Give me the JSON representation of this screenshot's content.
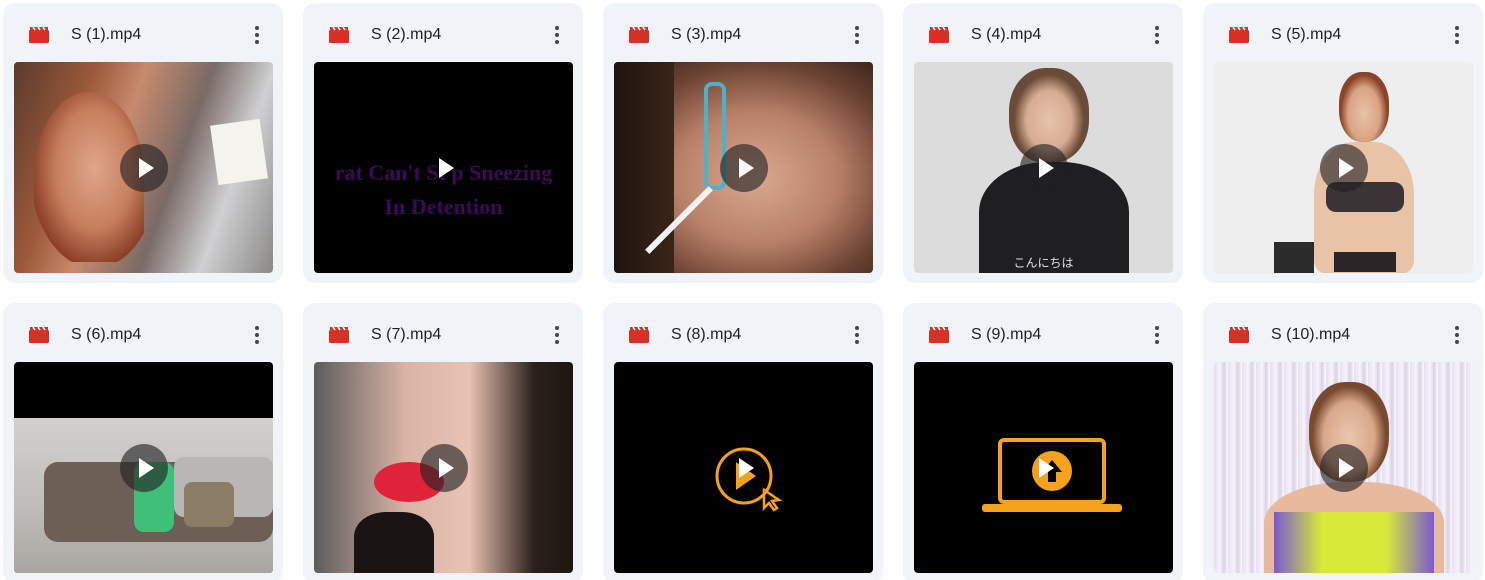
{
  "colors": {
    "card_bg": "#f0f4f9",
    "video_icon": "#d93025",
    "text": "#1f1f1f",
    "more_icon": "#444746"
  },
  "files": [
    {
      "name": "S (1).mp4",
      "icon": "video-file-icon"
    },
    {
      "name": "S (2).mp4",
      "icon": "video-file-icon",
      "overlay_line1": "rat Can't St p Sneezing",
      "overlay_line2": "In Detention"
    },
    {
      "name": "S (3).mp4",
      "icon": "video-file-icon"
    },
    {
      "name": "S (4).mp4",
      "icon": "video-file-icon",
      "caption": "こんにちは"
    },
    {
      "name": "S (5).mp4",
      "icon": "video-file-icon"
    },
    {
      "name": "S (6).mp4",
      "icon": "video-file-icon"
    },
    {
      "name": "S (7).mp4",
      "icon": "video-file-icon"
    },
    {
      "name": "S (8).mp4",
      "icon": "video-file-icon"
    },
    {
      "name": "S (9).mp4",
      "icon": "video-file-icon"
    },
    {
      "name": "S (10).mp4",
      "icon": "video-file-icon"
    }
  ],
  "more_icon": "more-vert-icon",
  "play_icon": "play-icon"
}
